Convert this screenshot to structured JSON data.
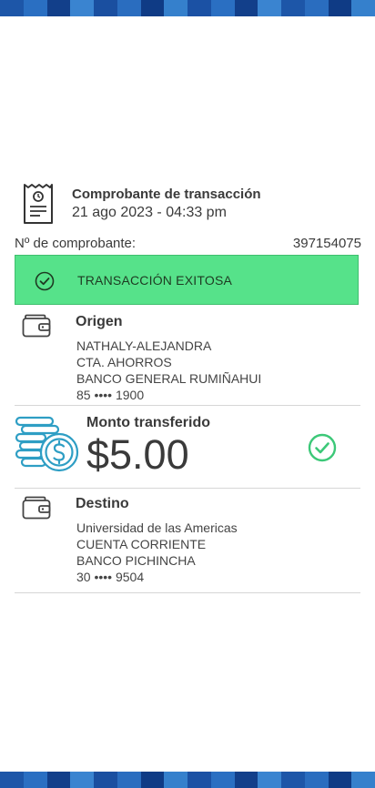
{
  "header": {
    "title": "Comprobante de transacción",
    "date": "21 ago 2023 - 04:33 pm"
  },
  "receipt": {
    "label": "Nº de comprobante:",
    "number": "397154075"
  },
  "status": {
    "text": "TRANSACCIÓN EXITOSA",
    "color": "#56e28a"
  },
  "origen": {
    "title": "Origen",
    "name": "NATHALY-ALEJANDRA",
    "account_type": "CTA. AHORROS",
    "bank": "BANCO GENERAL RUMIÑAHUI",
    "account": "85 •••• 1900"
  },
  "monto": {
    "title": "Monto transferido",
    "amount": "$5.00"
  },
  "destino": {
    "title": "Destino",
    "name": "Universidad de las Americas",
    "account_type": "CUENTA CORRIENTE",
    "bank": "BANCO PICHINCHA",
    "account": "30 •••• 9504"
  },
  "icons": {
    "receipt": "receipt-icon",
    "status": "check-circle-icon",
    "wallet": "wallet-icon",
    "coins": "coins-dollar-icon",
    "success": "check-circle-icon"
  },
  "colors": {
    "brand_blue": "#1a4fa8",
    "accent_teal": "#2e9ec4",
    "success_green": "#3cc878"
  }
}
